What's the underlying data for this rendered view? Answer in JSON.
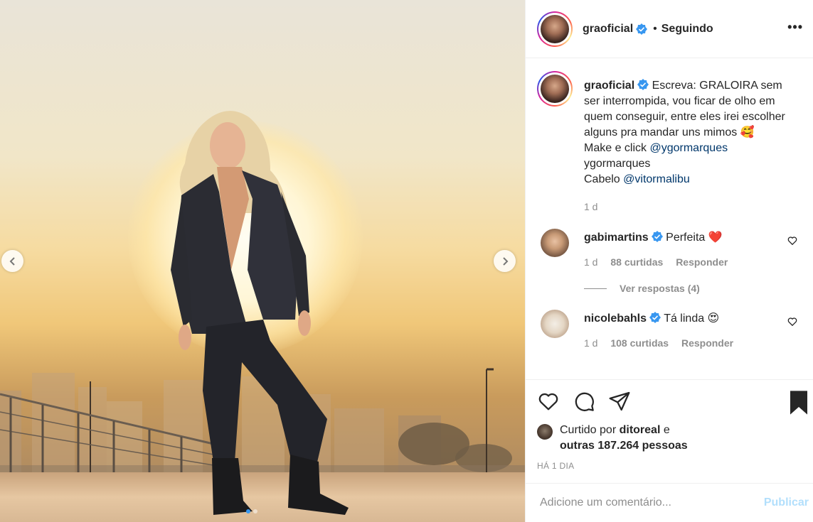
{
  "post": {
    "author": "graoficial",
    "follow_status": "Seguindo",
    "header_separator": "•",
    "more_label": "•••"
  },
  "caption": {
    "username": "graoficial",
    "text_1": "Escreva: GRALOIRA sem ser interrompida, vou ficar de olho em quem conseguir, entre eles irei escolher alguns pra mandar uns mimos 🥰",
    "makeup_prefix": "Make e click ",
    "makeup_mention": "@ygormarques",
    "makeup_name": "ygormarques",
    "hair_prefix": "Cabelo ",
    "hair_mention": "@vitormalibu",
    "time": "1 d"
  },
  "comments": [
    {
      "username": "gabimartins",
      "text": "Perfeita ❤️",
      "time": "1 d",
      "likes": "88 curtidas",
      "reply": "Responder",
      "view_replies": "Ver respostas (4)"
    },
    {
      "username": "nicolebahls",
      "text": "Tá linda 😍",
      "time": "1 d",
      "likes": "108 curtidas",
      "reply": "Responder"
    }
  ],
  "likes": {
    "prefix": "Curtido por ",
    "user": "ditoreal",
    "connector": " e",
    "others": "outras 187.264 pessoas"
  },
  "date": "HÁ 1 DIA",
  "comment_box": {
    "placeholder": "Adicione um comentário...",
    "publish": "Publicar"
  },
  "colors": {
    "verified": "#3897f0",
    "link": "#00376b",
    "muted": "#8e8e8e",
    "publish_disabled": "#b2dffc"
  },
  "carousel": {
    "total_slides": 2,
    "active_slide": 1
  }
}
